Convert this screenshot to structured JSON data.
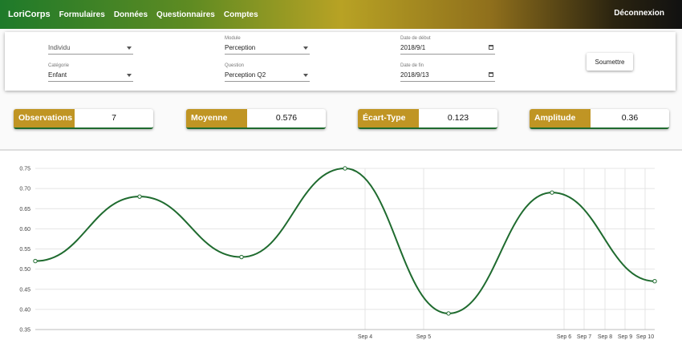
{
  "navbar": {
    "brand": "LoriCorps",
    "links": [
      "Formulaires",
      "Données",
      "Questionnaires",
      "Comptes"
    ],
    "logout": "Déconnexion"
  },
  "filters": {
    "individu": {
      "label": "",
      "value": "Individu"
    },
    "categorie": {
      "label": "Catégorie",
      "value": "Enfant"
    },
    "module": {
      "label": "Module",
      "value": "Perception"
    },
    "question": {
      "label": "Question",
      "value": "Perception Q2"
    },
    "date_debut": {
      "label": "Date de début",
      "value": "2018/9/1"
    },
    "date_fin": {
      "label": "Date de fin",
      "value": "2018/9/13"
    },
    "submit": "Soumettre"
  },
  "stats": [
    {
      "label": "Observations",
      "value": "7"
    },
    {
      "label": "Moyenne",
      "value": "0.576"
    },
    {
      "label": "Écart-Type",
      "value": "0.123"
    },
    {
      "label": "Amplitude",
      "value": "0.36"
    }
  ],
  "colors": {
    "accent": "#c09524",
    "line": "#1f6b2f"
  },
  "chart_data": {
    "type": "line",
    "title": "",
    "xlabel": "",
    "ylabel": "",
    "ylim": [
      0.35,
      0.75
    ],
    "y_ticks": [
      "0.75",
      "0.70",
      "0.65",
      "0.60",
      "0.55",
      "0.50",
      "0.45",
      "0.40",
      "0.35"
    ],
    "x_ticks": [
      "Sep 4",
      "Sep 5",
      "Sep 6",
      "Sep 7",
      "Sep 8",
      "Sep 9",
      "Sep 10"
    ],
    "grid": true,
    "series": [
      {
        "values": [
          0.52,
          0.68,
          0.53,
          0.75,
          0.39,
          0.69,
          0.47
        ]
      }
    ]
  }
}
